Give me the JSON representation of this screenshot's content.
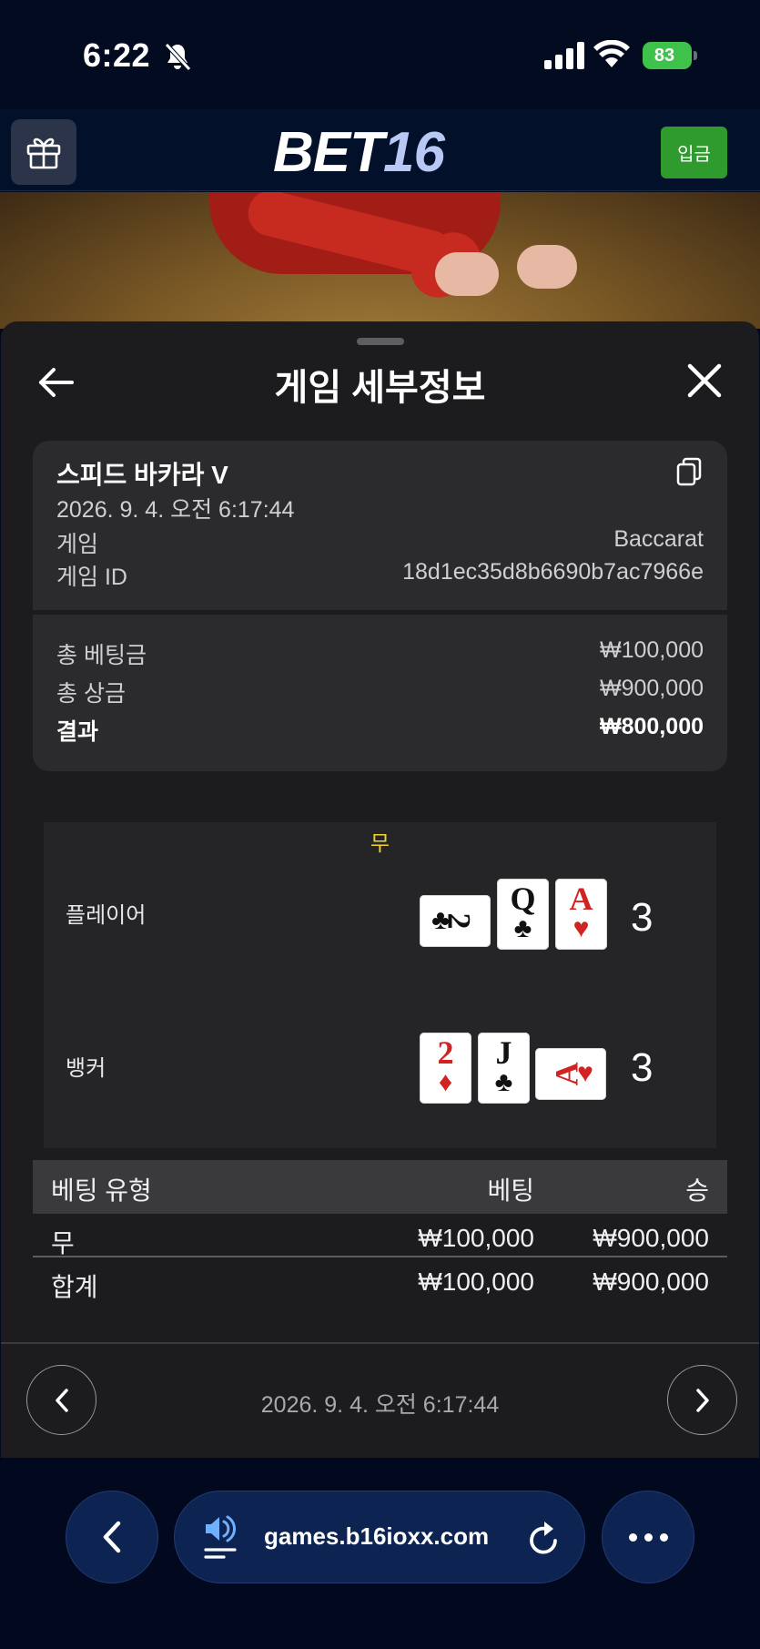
{
  "status_bar": {
    "time": "6:22",
    "battery": "83"
  },
  "header": {
    "logo_main": "BET",
    "logo_num": "16",
    "deposit_label": "입금"
  },
  "sheet": {
    "title": "게임 세부정보",
    "game": {
      "name": "스피드 바카라 V",
      "datetime": "2026. 9. 4. 오전 6:17:44",
      "rows": [
        {
          "label": "게임",
          "value": "Baccarat"
        },
        {
          "label": "게임 ID",
          "value": "18d1ec35d8b6690b7ac7966e"
        }
      ],
      "totals": [
        {
          "label": "총 베팅금",
          "value": "₩100,000"
        },
        {
          "label": "총 상금",
          "value": "₩900,000"
        },
        {
          "label": "결과",
          "value": "₩800,000"
        }
      ]
    },
    "round": {
      "outcome": "무",
      "player": {
        "label": "플레이어",
        "score": "3",
        "cards": [
          {
            "rank": "2",
            "suit": "♣",
            "color": "black",
            "sideways": true
          },
          {
            "rank": "Q",
            "suit": "♣",
            "color": "black",
            "sideways": false
          },
          {
            "rank": "A",
            "suit": "♥",
            "color": "red",
            "sideways": false
          }
        ]
      },
      "banker": {
        "label": "뱅커",
        "score": "3",
        "cards": [
          {
            "rank": "2",
            "suit": "♦",
            "color": "red",
            "sideways": false
          },
          {
            "rank": "J",
            "suit": "♣",
            "color": "black",
            "sideways": false
          },
          {
            "rank": "A",
            "suit": "♥",
            "color": "red",
            "sideways": true
          }
        ]
      }
    },
    "bets": {
      "headers": {
        "type": "베팅 유형",
        "bet": "베팅",
        "win": "승"
      },
      "rows": [
        {
          "type": "무",
          "bet": "₩100,000",
          "win": "₩900,000"
        }
      ],
      "total": {
        "type": "합계",
        "bet": "₩100,000",
        "win": "₩900,000"
      }
    },
    "footer_datetime": "2026. 9. 4. 오전 6:17:44"
  },
  "browser": {
    "url": "games.b16ioxx.com"
  },
  "colors": {
    "background": "#02091f",
    "sheet": "#1c1c1e",
    "card_panel": "#2b2b2e",
    "deposit_green": "#2f9a2e",
    "tie_yellow": "#f2d230",
    "card_red": "#d22323"
  },
  "icons": [
    "bell-slash-icon",
    "signal-icon",
    "wifi-icon",
    "battery-icon",
    "gift-icon",
    "arrow-left-icon",
    "close-icon",
    "copy-icon",
    "chevron-left-icon",
    "chevron-right-icon",
    "speaker-icon",
    "reload-icon",
    "more-icon"
  ]
}
